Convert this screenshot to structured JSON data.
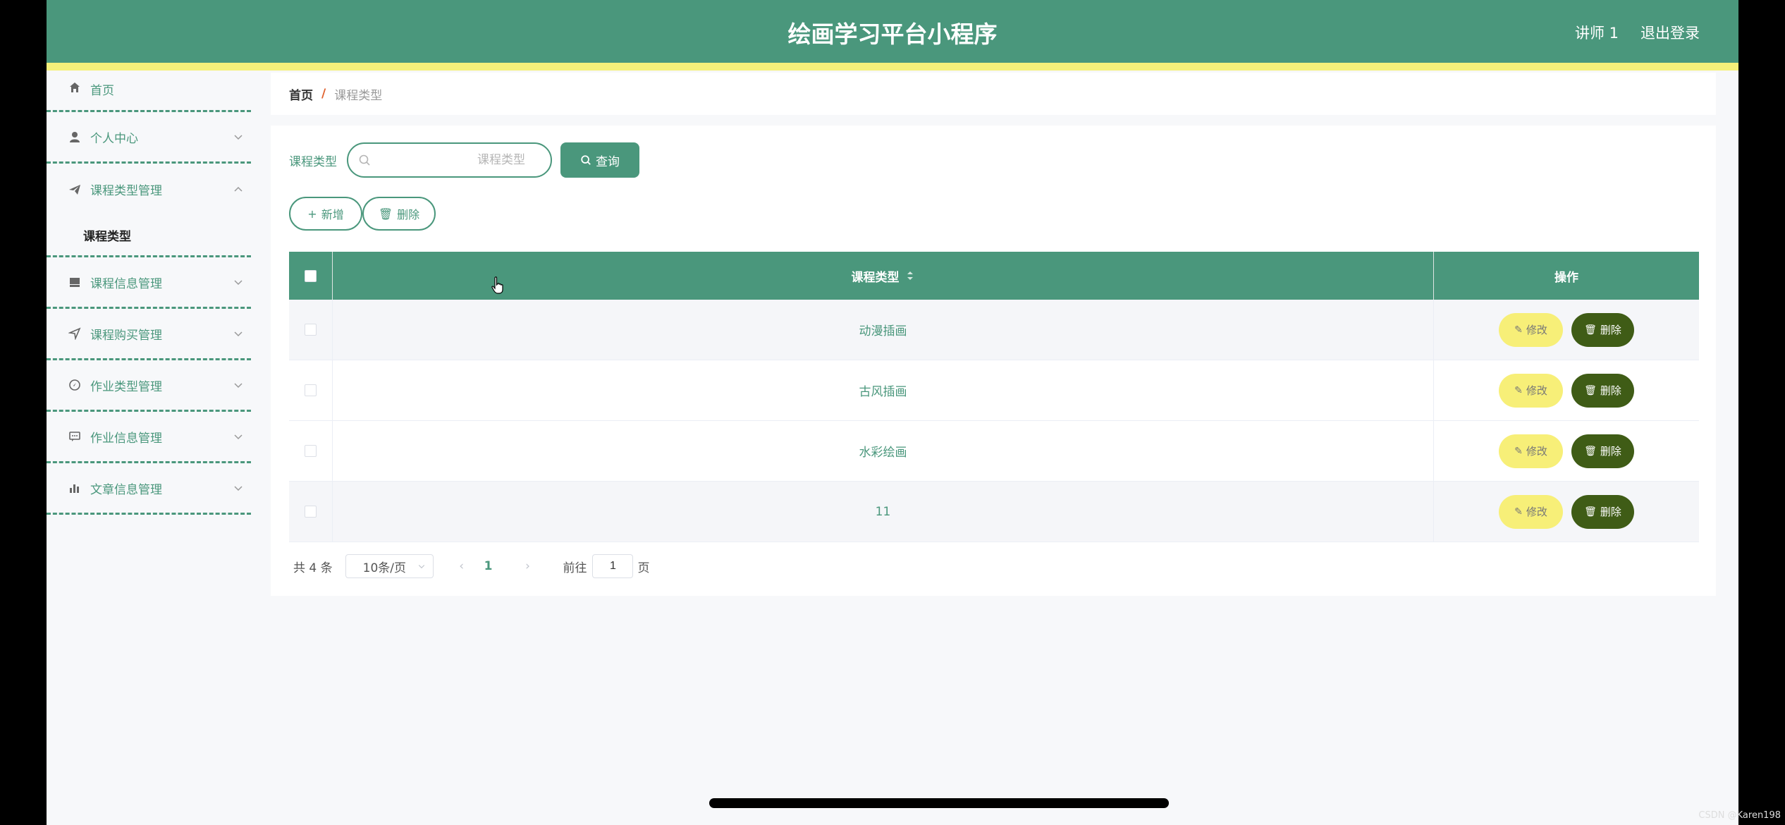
{
  "header": {
    "app_title": "绘画学习平台小程序",
    "user_label": "讲师 1",
    "logout_label": "退出登录"
  },
  "sidebar": {
    "items": [
      {
        "label": "首页",
        "icon": "home-icon"
      },
      {
        "label": "个人中心",
        "icon": "user-icon"
      },
      {
        "label": "课程类型管理",
        "icon": "send-icon",
        "expanded": true,
        "sub": [
          {
            "label": "课程类型"
          }
        ]
      },
      {
        "label": "课程信息管理",
        "icon": "inbox-icon"
      },
      {
        "label": "课程购买管理",
        "icon": "location-icon"
      },
      {
        "label": "作业类型管理",
        "icon": "compass-icon"
      },
      {
        "label": "作业信息管理",
        "icon": "chat-icon"
      },
      {
        "label": "文章信息管理",
        "icon": "chart-icon"
      }
    ]
  },
  "breadcrumb": {
    "home": "首页",
    "separator": "/",
    "current": "课程类型"
  },
  "search": {
    "label": "课程类型",
    "placeholder": "课程类型",
    "value": "",
    "query_button": "查询"
  },
  "actions": {
    "add_button": "新增",
    "delete_button": "删除"
  },
  "table": {
    "columns": [
      "课程类型",
      "操作"
    ],
    "rows": [
      {
        "type": "动漫插画"
      },
      {
        "type": "古风插画"
      },
      {
        "type": "水彩绘画"
      },
      {
        "type": "11"
      }
    ],
    "edit_label": "修改",
    "remove_label": "删除"
  },
  "pager": {
    "total": "共 4 条",
    "page_size": "10条/页",
    "current_page": "1",
    "goto_label": "前往",
    "goto_value": "1",
    "page_suffix": "页"
  },
  "watermark": "CSDN @Karen198",
  "colors": {
    "primary": "#4a977c",
    "accent_yellow": "#f5f07a",
    "edit_button": "#f7ef78",
    "remove_button": "#3f5c16"
  }
}
